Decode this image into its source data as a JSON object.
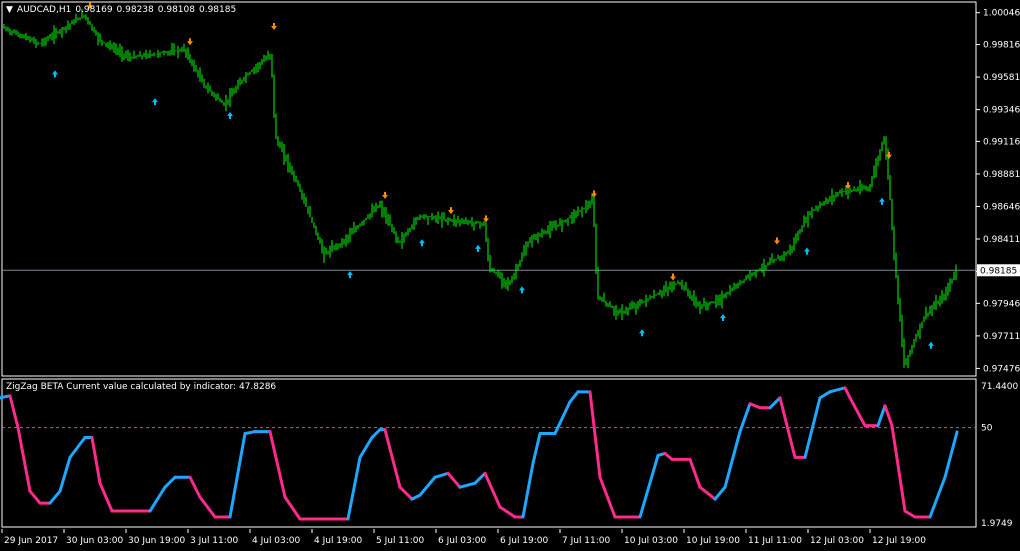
{
  "header": {
    "symbol": "AUDCAD,H1",
    "open": "0.98169",
    "high": "0.98238",
    "low": "0.98108",
    "close": "0.98185",
    "menu_icon": "triangle-down-icon"
  },
  "indicator": {
    "title": "ZigZag BETA Current value calculated by indicator: 47.8286",
    "level_label": "50",
    "max_label": "71.4400",
    "min_label": "1.9749"
  },
  "colors": {
    "background": "#000000",
    "candles": "#00ff00",
    "arrow_up": "#00bfff",
    "arrow_down": "#ff8c00",
    "line_rising": "#1ea7ff",
    "line_falling": "#ff2a8a",
    "level_line": "#d2691e",
    "current_price_line": "#778899"
  },
  "price_axis": {
    "ticks": [
      "1.00046",
      "0.99816",
      "0.99581",
      "0.99346",
      "0.99116",
      "0.98881",
      "0.98646",
      "0.98411",
      "0.98176",
      "0.97946",
      "0.97711",
      "0.97476"
    ],
    "current_price": "0.98185"
  },
  "time_axis": {
    "labels": [
      "29 Jun 2017",
      "30 Jun 03:00",
      "30 Jun 19:00",
      "3 Jul 11:00",
      "4 Jul 03:00",
      "4 Jul 19:00",
      "5 Jul 11:00",
      "6 Jul 03:00",
      "6 Jul 19:00",
      "7 Jul 11:00",
      "10 Jul 03:00",
      "10 Jul 19:00",
      "11 Jul 11:00",
      "12 Jul 03:00",
      "12 Jul 19:00"
    ]
  },
  "chart_data": {
    "type": "line",
    "price_ylim": [
      0.9745,
      1.0008
    ],
    "price_path": [
      [
        0,
        0.9995
      ],
      [
        40,
        0.9982
      ],
      [
        85,
        1.0003
      ],
      [
        100,
        0.9985
      ],
      [
        130,
        0.9972
      ],
      [
        185,
        0.9978
      ],
      [
        205,
        0.9952
      ],
      [
        225,
        0.9938
      ],
      [
        245,
        0.9958
      ],
      [
        272,
        0.9975
      ],
      [
        276,
        0.9915
      ],
      [
        300,
        0.9878
      ],
      [
        325,
        0.983
      ],
      [
        345,
        0.984
      ],
      [
        380,
        0.9866
      ],
      [
        400,
        0.9838
      ],
      [
        420,
        0.9858
      ],
      [
        450,
        0.9855
      ],
      [
        485,
        0.9852
      ],
      [
        490,
        0.982
      ],
      [
        510,
        0.9808
      ],
      [
        530,
        0.984
      ],
      [
        560,
        0.9852
      ],
      [
        594,
        0.9868
      ],
      [
        598,
        0.98
      ],
      [
        620,
        0.9787
      ],
      [
        660,
        0.9802
      ],
      [
        680,
        0.981
      ],
      [
        700,
        0.9792
      ],
      [
        720,
        0.9797
      ],
      [
        750,
        0.9815
      ],
      [
        790,
        0.9832
      ],
      [
        810,
        0.986
      ],
      [
        840,
        0.9875
      ],
      [
        870,
        0.9878
      ],
      [
        885,
        0.9915
      ],
      [
        890,
        0.988
      ],
      [
        895,
        0.983
      ],
      [
        905,
        0.975
      ],
      [
        925,
        0.9785
      ],
      [
        945,
        0.98
      ],
      [
        957,
        0.98185
      ]
    ],
    "arrows_up": [
      [
        55,
        0.996
      ],
      [
        155,
        0.994
      ],
      [
        230,
        0.993
      ],
      [
        350,
        0.9815
      ],
      [
        422,
        0.9838
      ],
      [
        478,
        0.9834
      ],
      [
        522,
        0.9804
      ],
      [
        642,
        0.9773
      ],
      [
        723,
        0.9784
      ],
      [
        807,
        0.9832
      ],
      [
        882,
        0.9868
      ],
      [
        931,
        0.9764
      ]
    ],
    "arrows_down": [
      [
        90,
        1.001
      ],
      [
        190,
        0.9984
      ],
      [
        274,
        0.9995
      ],
      [
        385,
        0.9873
      ],
      [
        451,
        0.9862
      ],
      [
        486,
        0.9856
      ],
      [
        594,
        0.9874
      ],
      [
        673,
        0.9814
      ],
      [
        777,
        0.984
      ],
      [
        848,
        0.988
      ],
      [
        889,
        0.9902
      ]
    ],
    "zigzag_ylim": [
      1.9749,
      71.44
    ],
    "zigzag_level": 50,
    "zigzag_path": [
      [
        0,
        65
      ],
      [
        10,
        66
      ],
      [
        18,
        50
      ],
      [
        30,
        18
      ],
      [
        40,
        12
      ],
      [
        50,
        12
      ],
      [
        60,
        18
      ],
      [
        70,
        35
      ],
      [
        85,
        45
      ],
      [
        92,
        45
      ],
      [
        100,
        22
      ],
      [
        112,
        8
      ],
      [
        130,
        8
      ],
      [
        150,
        8
      ],
      [
        165,
        20
      ],
      [
        175,
        25
      ],
      [
        190,
        25
      ],
      [
        200,
        15
      ],
      [
        215,
        5
      ],
      [
        230,
        5
      ],
      [
        245,
        47
      ],
      [
        255,
        48
      ],
      [
        270,
        48
      ],
      [
        285,
        15
      ],
      [
        300,
        4
      ],
      [
        325,
        4
      ],
      [
        348,
        4
      ],
      [
        360,
        35
      ],
      [
        372,
        45
      ],
      [
        380,
        49
      ],
      [
        385,
        49
      ],
      [
        400,
        20
      ],
      [
        412,
        14
      ],
      [
        420,
        16
      ],
      [
        435,
        25
      ],
      [
        448,
        27
      ],
      [
        460,
        20
      ],
      [
        475,
        22
      ],
      [
        485,
        27
      ],
      [
        500,
        10
      ],
      [
        515,
        5
      ],
      [
        523,
        5
      ],
      [
        533,
        32
      ],
      [
        540,
        47
      ],
      [
        555,
        47
      ],
      [
        570,
        63
      ],
      [
        578,
        68
      ],
      [
        590,
        68
      ],
      [
        600,
        25
      ],
      [
        615,
        5
      ],
      [
        640,
        5
      ],
      [
        658,
        36
      ],
      [
        665,
        37
      ],
      [
        672,
        34
      ],
      [
        690,
        34
      ],
      [
        700,
        20
      ],
      [
        715,
        14
      ],
      [
        725,
        20
      ],
      [
        740,
        48
      ],
      [
        750,
        62
      ],
      [
        760,
        60
      ],
      [
        770,
        60
      ],
      [
        780,
        65
      ],
      [
        795,
        35
      ],
      [
        805,
        35
      ],
      [
        820,
        65
      ],
      [
        830,
        68
      ],
      [
        845,
        70
      ],
      [
        850,
        65
      ],
      [
        865,
        51
      ],
      [
        878,
        51
      ],
      [
        885,
        61
      ],
      [
        892,
        51
      ],
      [
        905,
        8
      ],
      [
        915,
        5
      ],
      [
        930,
        5
      ],
      [
        945,
        25
      ],
      [
        957,
        47.8
      ]
    ]
  }
}
